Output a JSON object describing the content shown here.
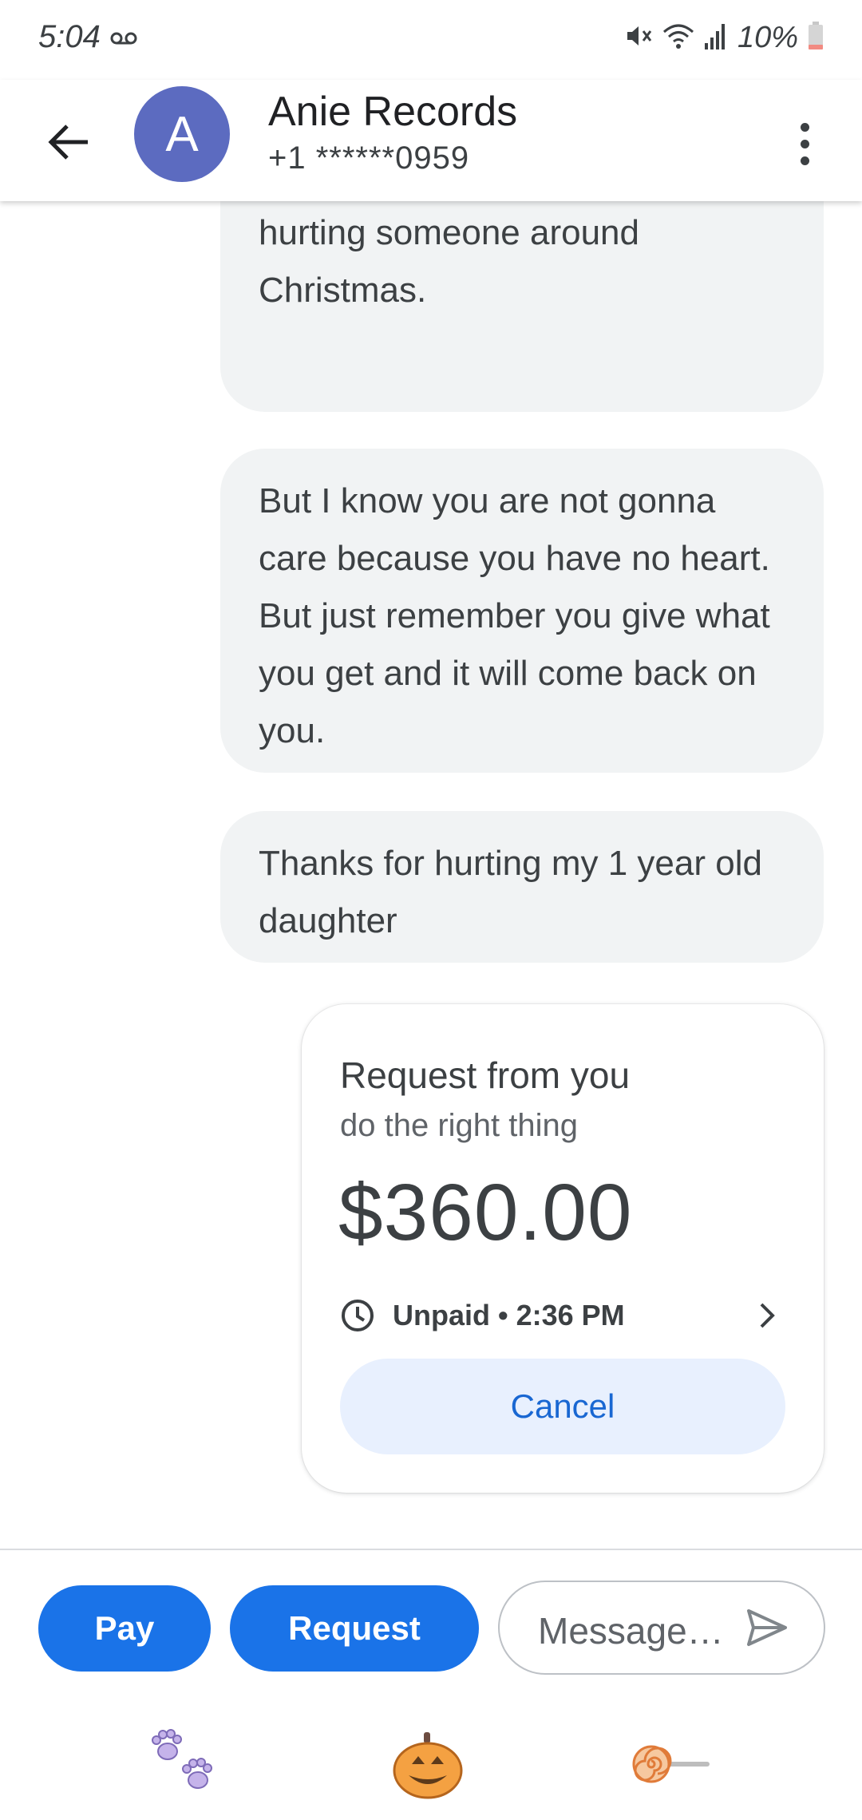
{
  "status_bar": {
    "time": "5:04",
    "battery": "10%",
    "icons": [
      "voicemail-icon",
      "mute-icon",
      "wifi-icon",
      "signal-icon",
      "battery-icon"
    ]
  },
  "header": {
    "avatar_letter": "A",
    "contact_name": "Anie Records",
    "contact_phone": "+1 ******0959",
    "icons": [
      "back-arrow-icon",
      "more-vert-icon"
    ]
  },
  "messages": [
    {
      "text": "an honest person. Thanks for hurting someone around Christmas."
    },
    {
      "text": "But I know you are not gonna care because you have no heart. But just remember you give what you get and it will come back on you."
    },
    {
      "text": "Thanks for hurting my 1 year old daughter"
    }
  ],
  "request_card": {
    "title": "Request from you",
    "note": "do the right thing",
    "amount": "$360.00",
    "status": "Unpaid • 2:36 PM",
    "cancel_label": "Cancel"
  },
  "compose": {
    "pay_label": "Pay",
    "request_label": "Request",
    "message_placeholder": "Message…"
  },
  "stickers": [
    "paws-sticker",
    "pumpkin-sticker",
    "lollipop-sticker"
  ],
  "colors": {
    "accent": "#1a73e8",
    "avatar": "#5c6bc0",
    "bubble": "#f1f3f4",
    "cancel_bg": "#e8f0fe",
    "cancel_text": "#1967d2"
  }
}
